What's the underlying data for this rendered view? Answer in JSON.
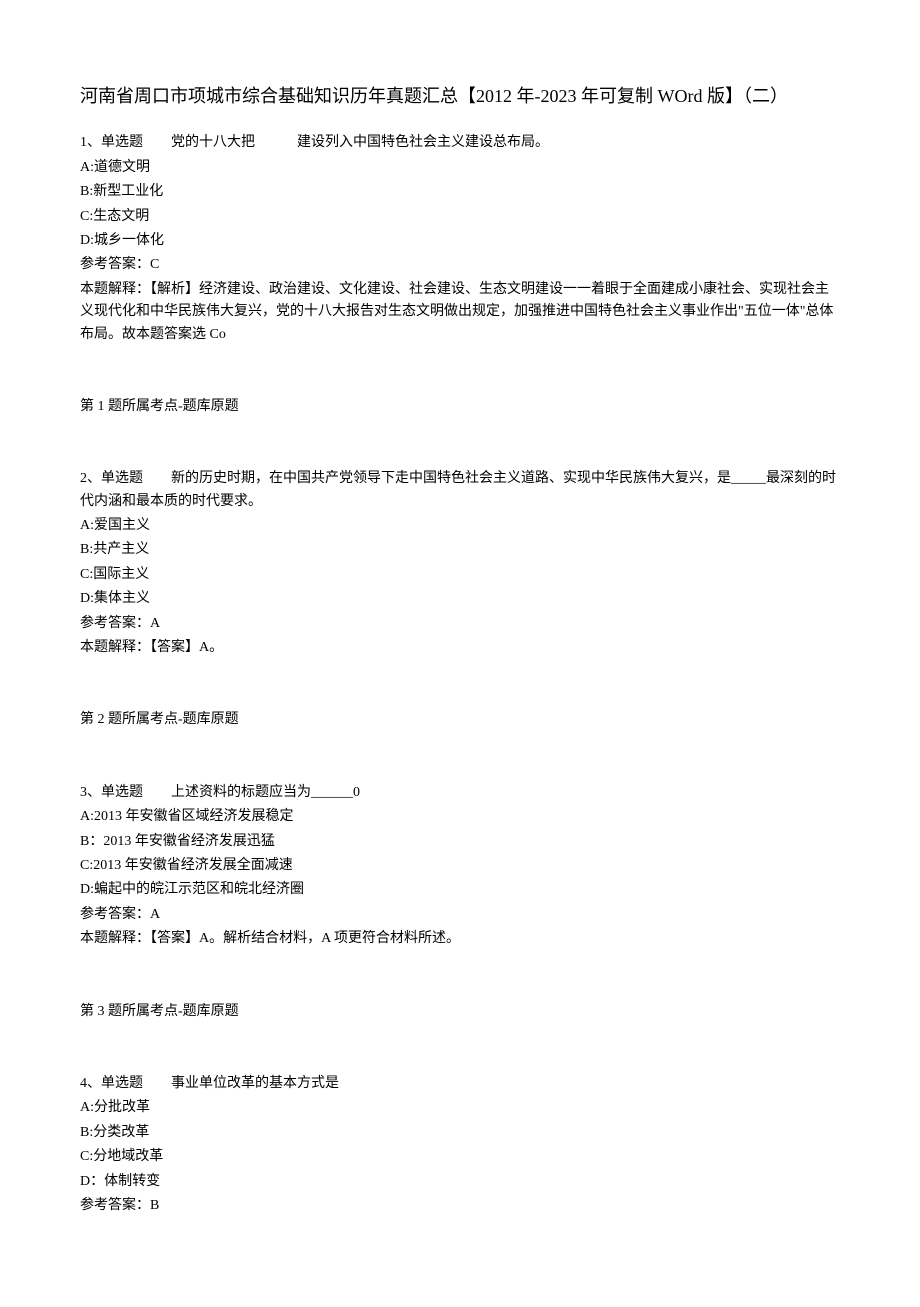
{
  "title": "河南省周口市项城市综合基础知识历年真题汇总【2012 年-2023 年可复制 WOrd 版】（二）",
  "questions": [
    {
      "number": "1、单选题　　党的十八大把　　　建设列入中国特色社会主义建设总布局。",
      "options": [
        "A:道德文明",
        "B:新型工业化",
        "C:生态文明",
        "D:城乡一体化"
      ],
      "answer": "参考答案：C",
      "explanation": "本题解释：【解析】经济建设、政治建设、文化建设、社会建设、生态文明建设一一着眼于全面建成小康社会、实现社会主义现代化和中华民族伟大复兴，党的十八大报告对生态文明做出规定，加强推进中国特色社会主义事业作出\"五位一体\"总体布局。故本题答案选 Co",
      "topic": "第 1 题所属考点-题库原题"
    },
    {
      "number": "2、单选题　　新的历史时期，在中国共产党领导下走中国特色社会主义道路、实现中华民族伟大复兴，是_____最深刻的时代内涵和最本质的时代要求。",
      "options": [
        "A:爱国主义",
        "B:共产主义",
        "C:国际主义",
        "D:集体主义"
      ],
      "answer": "参考答案：A",
      "explanation": "本题解释：【答案】A。",
      "topic": "第 2 题所属考点-题库原题"
    },
    {
      "number": "3、单选题　　上述资料的标题应当为______0",
      "options": [
        "A:2013 年安徽省区域经济发展稳定",
        "B：2013 年安徽省经济发展迅猛",
        "C:2013 年安徽省经济发展全面减速",
        "D:蝙起中的皖江示范区和皖北经济圈"
      ],
      "answer": "参考答案：A",
      "explanation": "本题解释：【答案】A。解析结合材料，A 项更符合材料所述。",
      "topic": "第 3 题所属考点-题库原题"
    },
    {
      "number": "4、单选题　　事业单位改革的基本方式是",
      "options": [
        "A:分批改革",
        "B:分类改革",
        "C:分地域改革",
        "D：体制转变"
      ],
      "answer": "参考答案：B",
      "explanation": "",
      "topic": ""
    }
  ]
}
